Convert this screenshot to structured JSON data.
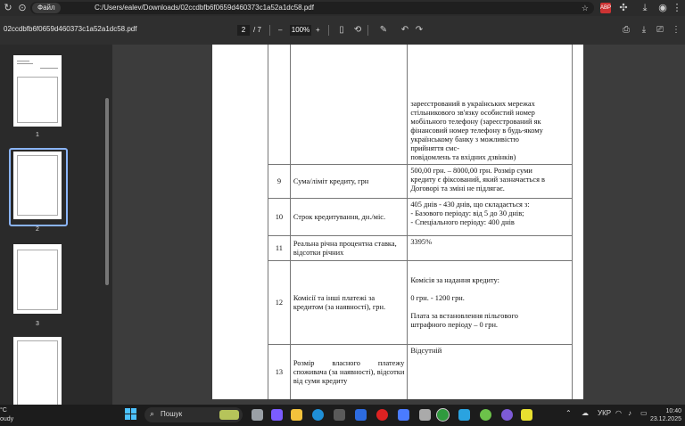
{
  "browser": {
    "file_chip": "Файл",
    "url": "C:/Users/ealev/Downloads/02ccdbfb6f0659d460373c1a52a1dc58.pdf",
    "ext_badge": "ABP"
  },
  "pdf_toolbar": {
    "filename": "02ccdbfb6f0659d460373c1a52a1dc58.pdf",
    "current_page": "2",
    "total_pages": "/ 7",
    "zoom": "100%",
    "minus": "–",
    "plus": "+"
  },
  "thumbnails": [
    {
      "label": "1"
    },
    {
      "label": "2"
    },
    {
      "label": "3"
    }
  ],
  "table_rows": [
    {
      "num": "",
      "name": "",
      "value_lines": [
        "зареєстрований в українських мережах",
        "стільникового зв'язку особистий номер",
        "мобільного телефону (зареєстрований як",
        "фінансовий номер телефону в будь-якому",
        "українському банку з можливістю",
        "прийняття смс-",
        "повідомлень та вхідних дзвінків)"
      ]
    },
    {
      "num": "9",
      "name": "Сума/ліміт кредиту, грн",
      "value_lines": [
        "500,00 грн. – 8000,00 грн. Розмір суми",
        "кредиту є фіксований, який зазначається в",
        "Договорі та зміні не підлягає."
      ]
    },
    {
      "num": "10",
      "name": "Строк кредитування, дн./міс.",
      "value_lines": [
        "405 днів - 430 днів, що складається з:",
        "-    Базового періоду: від 5 до 30 днів;",
        "-    Спеціального періоду: 400 днів"
      ]
    },
    {
      "num": "11",
      "name": "Реальна річна процентна ставка, відсотки річних",
      "value_lines": [
        "3395%"
      ]
    },
    {
      "num": "12",
      "name": "Комісії та інші платежі за кредитом (за наявності), грн.",
      "value_lines": [
        "Комісія за надання кредиту:",
        "",
        "0 грн. - 1200 грн.",
        "",
        "Плата за встановлення пільгового",
        "штрафного періоду – 0 грн."
      ]
    },
    {
      "num": "13",
      "name": "Розмір власного платежу споживача (за наявності), відсотки від суми кредиту",
      "value_lines": [
        "Відсутній"
      ]
    }
  ],
  "taskbar": {
    "weather_temp": "°C",
    "weather_desc": "oudy",
    "search_placeholder": "Пошук",
    "lang": "УКР",
    "time": "10:40",
    "date": "23.12.2025"
  }
}
